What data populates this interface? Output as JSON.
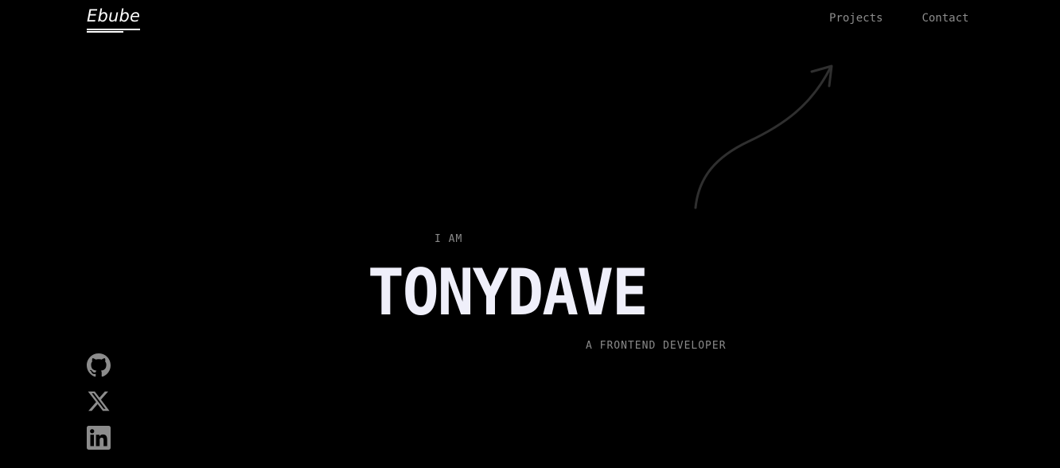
{
  "header": {
    "logo": "Ebube",
    "nav": [
      "Projects",
      "Contact"
    ]
  },
  "hero": {
    "eyebrow": "I AM",
    "name": "TONYDAVE",
    "role": "A FRONTEND DEVELOPER"
  },
  "social": [
    {
      "icon": "github-icon"
    },
    {
      "icon": "x-twitter-icon"
    },
    {
      "icon": "linkedin-icon"
    }
  ],
  "colors": {
    "background": "#000000",
    "name": "#efeffa",
    "muted": "#8a8a8a",
    "icon": "#8c8c8c",
    "arrow": "#2f2f2f"
  }
}
